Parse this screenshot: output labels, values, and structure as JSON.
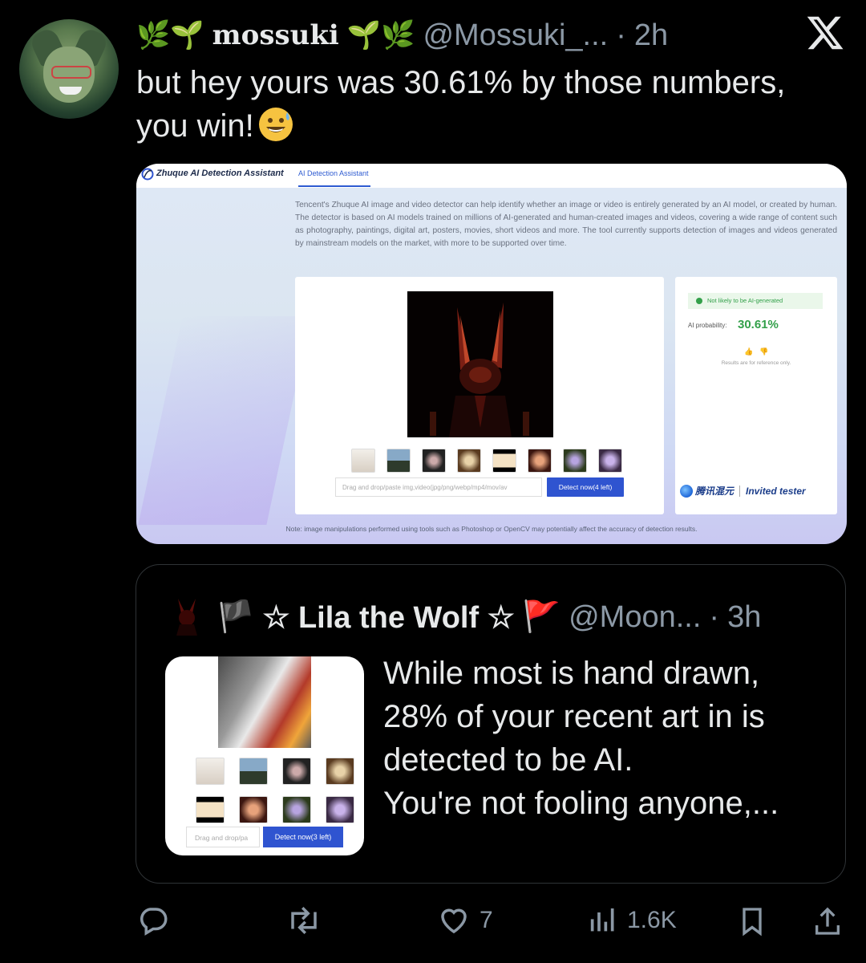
{
  "tweet": {
    "display_name": "mossuki",
    "handle": "@Mossuki_...",
    "separator": "·",
    "time": "2h",
    "text": "but hey yours was 30.61% by those numbers,\nyou win!"
  },
  "screenshot": {
    "brand": "Zhuque AI Detection Assistant",
    "nav_tab": "AI Detection Assistant",
    "description": "Tencent's Zhuque AI image and video detector can help identify whether an image or video is entirely generated by an AI model, or created by human. The detector is based on AI models trained on millions of AI-generated and human-created images and videos, covering a wide range of content such as photography, paintings, digital art, posters, movies, short videos and more. The tool currently supports detection of images and videos generated by mainstream models on the market, with more to be supported over time.",
    "result_badge": "Not likely to be AI-generated",
    "probability_label": "AI probability:",
    "probability_value": "30.61%",
    "reference_note": "Results are for reference only.",
    "drop_placeholder": "Drag and drop/paste img,video(jpg/png/webp/mp4/mov/av",
    "detect_button": "Detect now(4 left)",
    "partner_text": "腾讯混元",
    "invited": "Invited tester",
    "footnote": "Note: image manipulations performed using tools such as Photoshop or OpenCV may potentially affect the accuracy of detection results."
  },
  "quote": {
    "flag_prefix": "🏴",
    "display_name": "☆ Lila the Wolf ☆",
    "flag_suffix": "🚩",
    "handle": "@Moon...",
    "separator": "·",
    "time": "3h",
    "text": "While most is hand drawn,\n28% of your recent art in is\ndetected to be AI.\nYou're not fooling anyone,...",
    "drop_placeholder": "Drag and drop/pa",
    "detect_button": "Detect now(3 left)"
  },
  "actions": {
    "replies": "",
    "reposts": "",
    "likes": "7",
    "views": "1.6K"
  },
  "icons": [
    "leaf-sprout-icon",
    "x-logo-icon",
    "reply-icon",
    "repost-icon",
    "heart-icon",
    "views-icon",
    "bookmark-icon",
    "share-icon"
  ],
  "colors": {
    "background": "#000000",
    "text": "#e7e9ea",
    "muted": "#8b98a5",
    "accent_green": "#33a04a",
    "button_blue": "#2f54d0"
  }
}
